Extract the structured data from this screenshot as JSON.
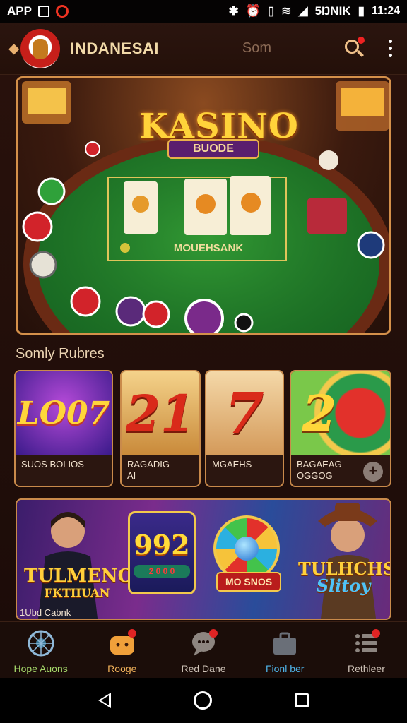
{
  "status_bar": {
    "app_label": "APP",
    "carrier": "5ŊNIK",
    "time": "11:24"
  },
  "header": {
    "title": "INDANESAI",
    "search_text": "Som"
  },
  "hero": {
    "title": "KASINO",
    "subtitle": "BUODE",
    "table_label": "MOUEHSANK"
  },
  "section": {
    "title": "Somly Rubres"
  },
  "games": [
    {
      "art": "LO07",
      "label": "SUOS BOLIOS"
    },
    {
      "art": "21",
      "label": "RAGADIG\nAI"
    },
    {
      "art": "7",
      "label": "MGAEHS"
    },
    {
      "art": "2",
      "label": "BAGAEAG\nOGGOG"
    }
  ],
  "promo": {
    "left_line1": "TULMENO",
    "left_line2": "FKTIIUAN",
    "slot_number": "992",
    "slot_row": "2 0 0 0",
    "wheel_label": "MO SNOS",
    "right_line1": "TULHCHS",
    "right_line2": "Slitoy",
    "caption": "1Ubd Cabnk"
  },
  "bottom_nav": [
    {
      "label": "Hope Auons",
      "color": "#a5d86a",
      "badge": false
    },
    {
      "label": "Rooge",
      "color": "#f0b15a",
      "badge": true
    },
    {
      "label": "Red Dane",
      "color": "#cfc3b8",
      "badge": true
    },
    {
      "label": "Fionl ber",
      "color": "#4fb3e8",
      "badge": false
    },
    {
      "label": "Rethleer",
      "color": "#cfc3b8",
      "badge": true
    }
  ]
}
